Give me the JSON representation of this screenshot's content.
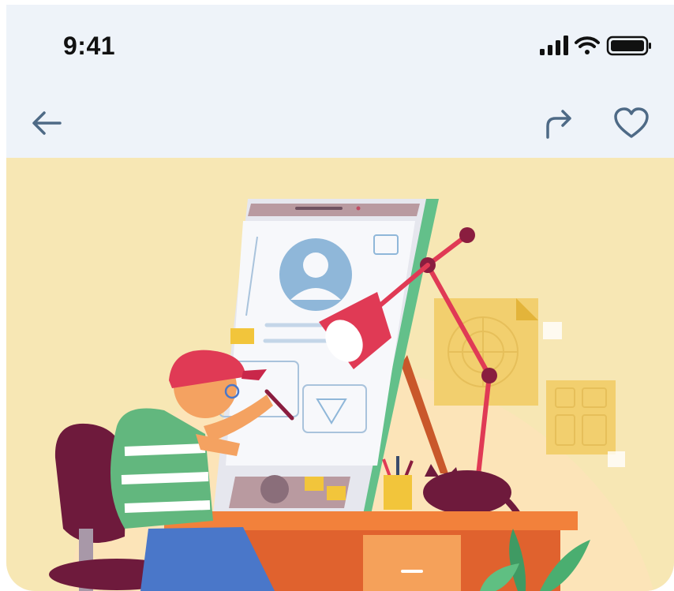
{
  "status_bar": {
    "time": "9:41",
    "icons": [
      "cellular-signal-icon",
      "wifi-icon",
      "battery-icon"
    ]
  },
  "nav_bar": {
    "icons": [
      "back-arrow-icon",
      "share-icon",
      "heart-icon"
    ],
    "icon_color": "#4e6a86"
  },
  "hero": {
    "background": "#f7e7b4",
    "subject": "illustration-designer-at-drafting-table"
  }
}
